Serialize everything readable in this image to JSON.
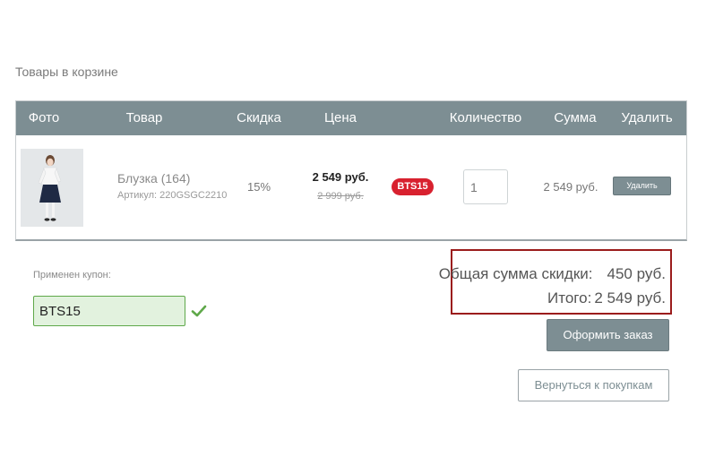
{
  "cart": {
    "section_title": "Товары в корзине",
    "columns": {
      "photo": "Фото",
      "product": "Товар",
      "discount": "Скидка",
      "price": "Цена",
      "quantity": "Количество",
      "sum": "Сумма",
      "delete": "Удалить"
    },
    "items": [
      {
        "name": "Блузка (164)",
        "sku": "Артикул: 220GSGC2210",
        "discount": "15%",
        "price": "2 549 руб.",
        "old_price": "2 999 руб.",
        "coupon_badge": "BTS15",
        "quantity": "1",
        "sum": "2 549 руб.",
        "delete_label": "Удалить"
      }
    ]
  },
  "coupon": {
    "label": "Применен купон:",
    "value": "BTS15"
  },
  "totals": {
    "discount_label": "Общая сумма скидки:",
    "discount_value": "450 руб.",
    "total_label": "Итого:",
    "total_value": "2 549 руб."
  },
  "actions": {
    "checkout_label": "Оформить заказ",
    "back_label": "Вернуться к покупкам"
  },
  "colors": {
    "header_bg": "#7d8e93",
    "badge_red": "#d8212f",
    "coupon_green_bg": "#e2f2de",
    "coupon_green_border": "#5fa84a",
    "highlight_box": "#9b1c1c"
  }
}
